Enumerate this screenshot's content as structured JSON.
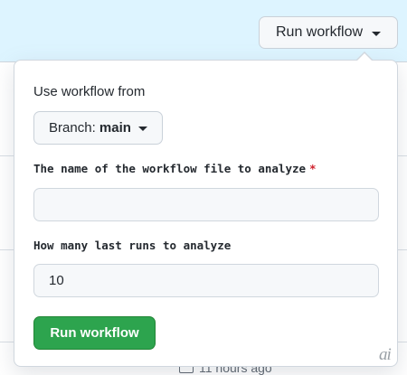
{
  "header": {
    "run_workflow_label": "Run workflow",
    "caret_icon": "triangle-down-icon"
  },
  "popover": {
    "use_workflow_from_label": "Use workflow from",
    "branch": {
      "prefix": "Branch: ",
      "name": "main"
    },
    "fields": [
      {
        "label": "The name of the workflow file to analyze",
        "required": true,
        "required_marker": "*",
        "value": ""
      },
      {
        "label": "How many last runs to analyze",
        "required": false,
        "value": "10"
      }
    ],
    "submit_label": "Run workflow"
  },
  "background": {
    "peek_text": "11 hours ago"
  },
  "colors": {
    "header_bg": "#ddf4ff",
    "primary_button": "#2da44e",
    "required_star": "#cf222e",
    "field_bg": "#f6f8fa",
    "border": "#d0d7de"
  }
}
